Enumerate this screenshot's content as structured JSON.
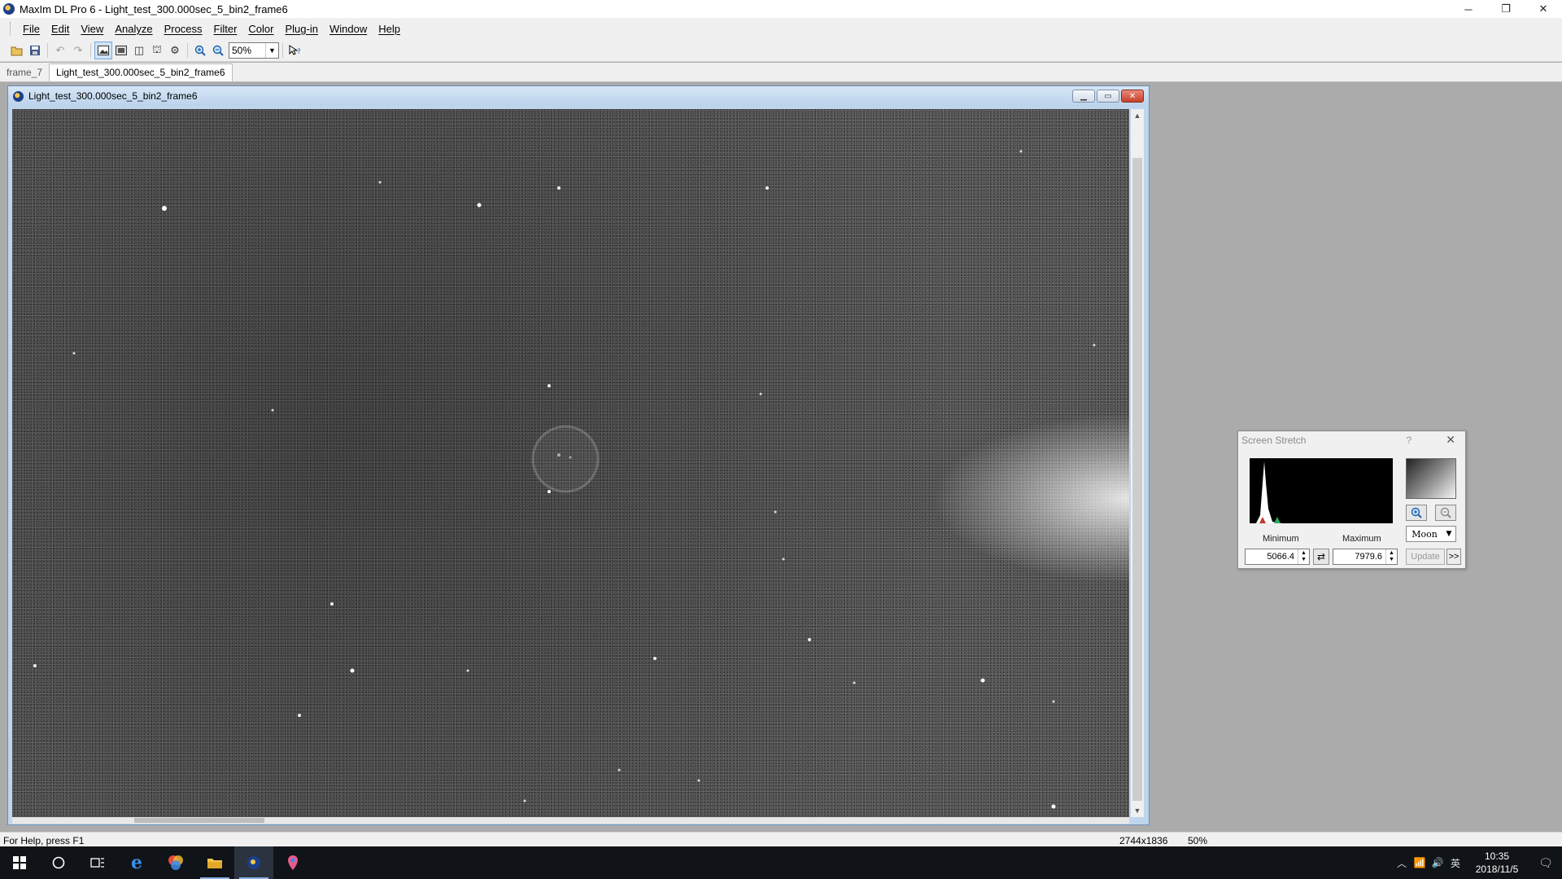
{
  "app": {
    "title": "MaxIm DL Pro 6 - Light_test_300.000sec_5_bin2_frame6",
    "window_controls": {
      "minimize": "─",
      "restore": "❐",
      "close": "✕"
    }
  },
  "menu": [
    "File",
    "Edit",
    "View",
    "Analyze",
    "Process",
    "Filter",
    "Color",
    "Plug-in",
    "Window",
    "Help"
  ],
  "toolbar": {
    "zoom_value": "50%",
    "icons": [
      "open-icon",
      "save-icon",
      "undo-icon",
      "redo-icon",
      "image-view-icon",
      "screen-stretch-icon",
      "flip-icon",
      "tools-icon",
      "settings-icon",
      "zoom-in-icon",
      "zoom-out-icon",
      "context-help-icon"
    ]
  },
  "doc_tabs": [
    "frame_7",
    "Light_test_300.000sec_5_bin2_frame6"
  ],
  "image_window": {
    "title": "Light_test_300.000sec_5_bin2_frame6"
  },
  "screen_stretch": {
    "title": "Screen Stretch",
    "help": "?",
    "close": "✕",
    "min_label": "Minimum",
    "max_label": "Maximum",
    "min_value": "5066.4",
    "max_value": "7979.6",
    "mode": "Moon",
    "update_label": "Update",
    "more_label": ">>"
  },
  "status": {
    "help_text": "For Help, press F1",
    "dimensions": "2744x1836",
    "zoom": "50%"
  },
  "taskbar": {
    "tray_lang": "英",
    "time": "10:35",
    "date": "2018/11/5"
  },
  "colors": {
    "image_background": "#4a4a4a",
    "mdi_background": "#ababab",
    "taskbar": "#101418"
  }
}
